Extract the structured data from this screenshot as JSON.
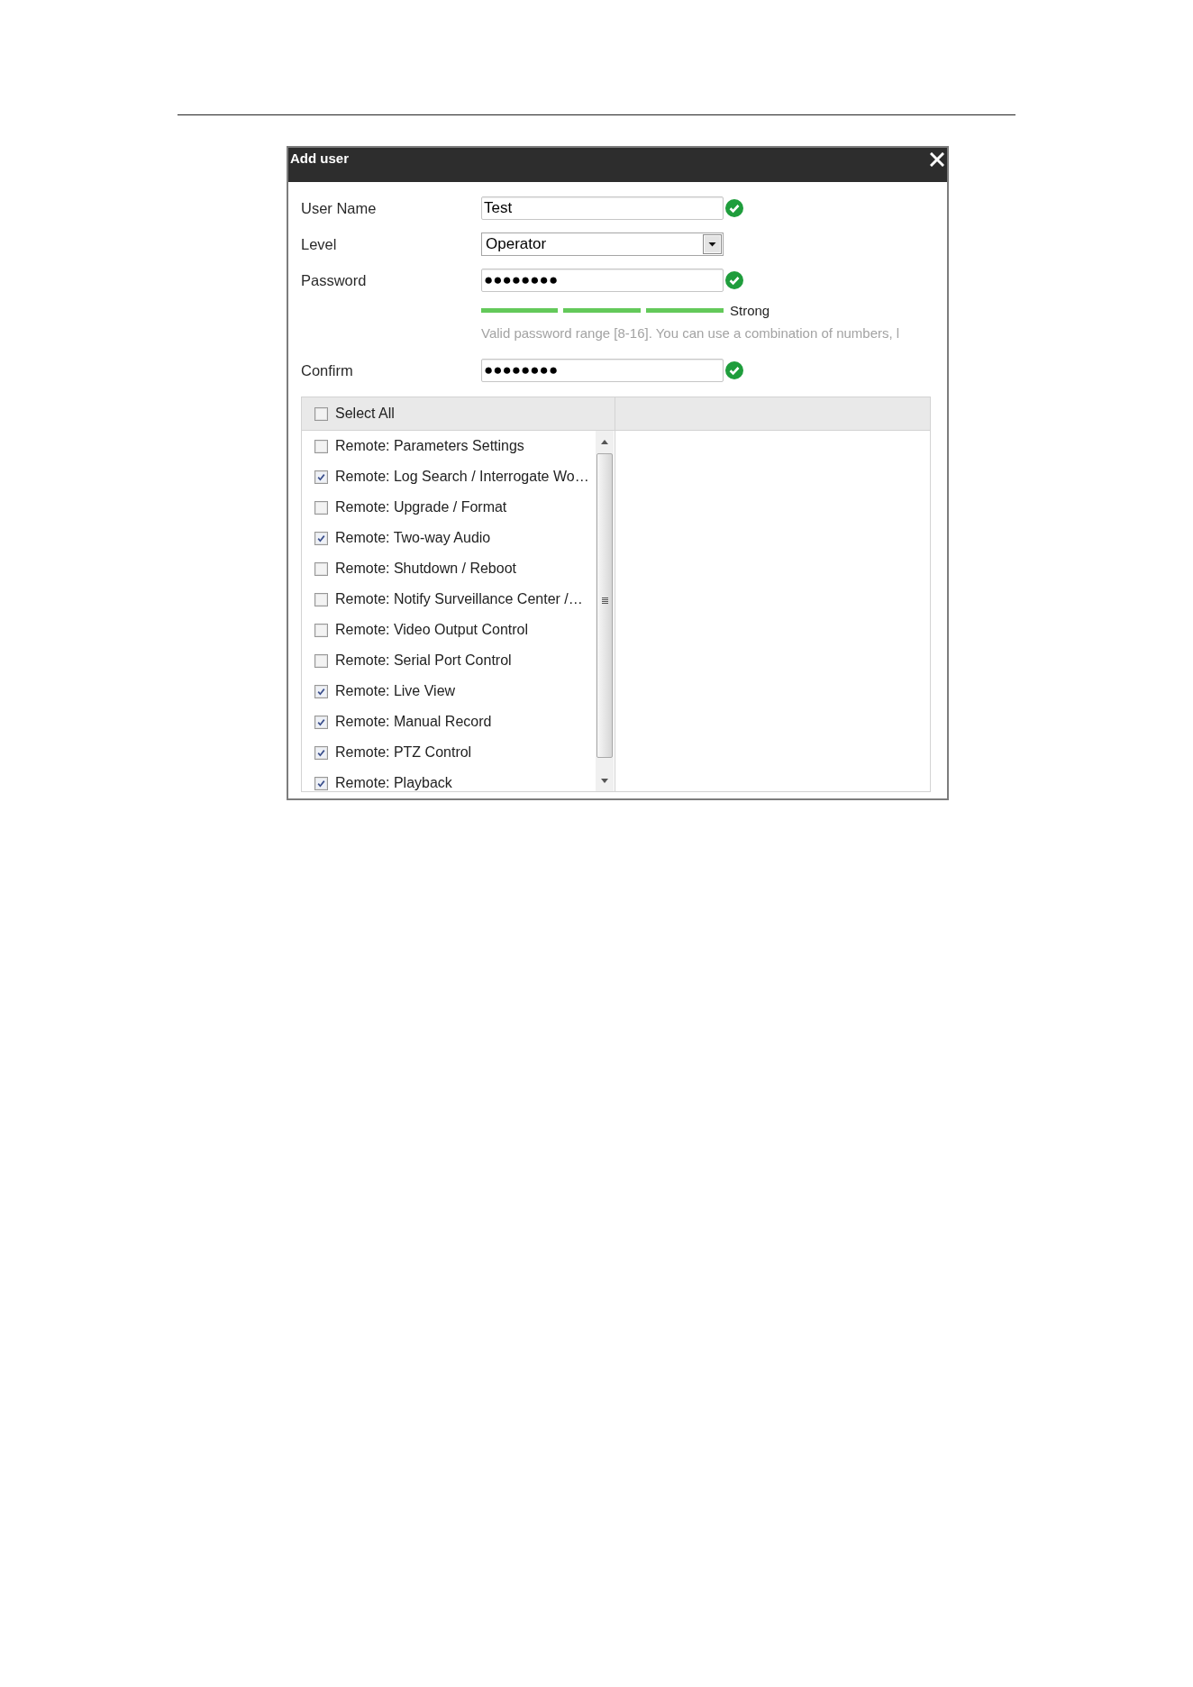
{
  "dialog": {
    "title": "Add user"
  },
  "form": {
    "fields": [
      {
        "kind": "text",
        "label": "User Name",
        "value": "Test",
        "valid": true
      },
      {
        "kind": "dropdown",
        "label": "Level",
        "value": "Operator"
      },
      {
        "kind": "password",
        "label": "Password",
        "value": "●●●●●●●●",
        "valid": true,
        "strength": {
          "level": 1,
          "label": "Strong"
        },
        "hint": "Valid password range [8-16]. You can use a combination of numbers, l"
      },
      {
        "kind": "password",
        "label": "Confirm",
        "value": "●●●●●●●●",
        "valid": true
      }
    ]
  },
  "permissions": {
    "select_all": {
      "label": "Select All",
      "checked": false
    },
    "items": [
      {
        "label": "Remote: Parameters Settings",
        "checked": false
      },
      {
        "label": "Remote: Log Search / Interrogate Wo…",
        "checked": true
      },
      {
        "label": "Remote: Upgrade / Format",
        "checked": false
      },
      {
        "label": "Remote: Two-way Audio",
        "checked": true
      },
      {
        "label": "Remote: Shutdown / Reboot",
        "checked": false
      },
      {
        "label": "Remote: Notify Surveillance Center /…",
        "checked": false
      },
      {
        "label": "Remote: Video Output Control",
        "checked": false
      },
      {
        "label": "Remote: Serial Port Control",
        "checked": false
      },
      {
        "label": "Remote: Live View",
        "checked": true
      },
      {
        "label": "Remote: Manual Record",
        "checked": true
      },
      {
        "label": "Remote: PTZ Control",
        "checked": true
      },
      {
        "label": "Remote: Playback",
        "checked": true
      }
    ]
  }
}
